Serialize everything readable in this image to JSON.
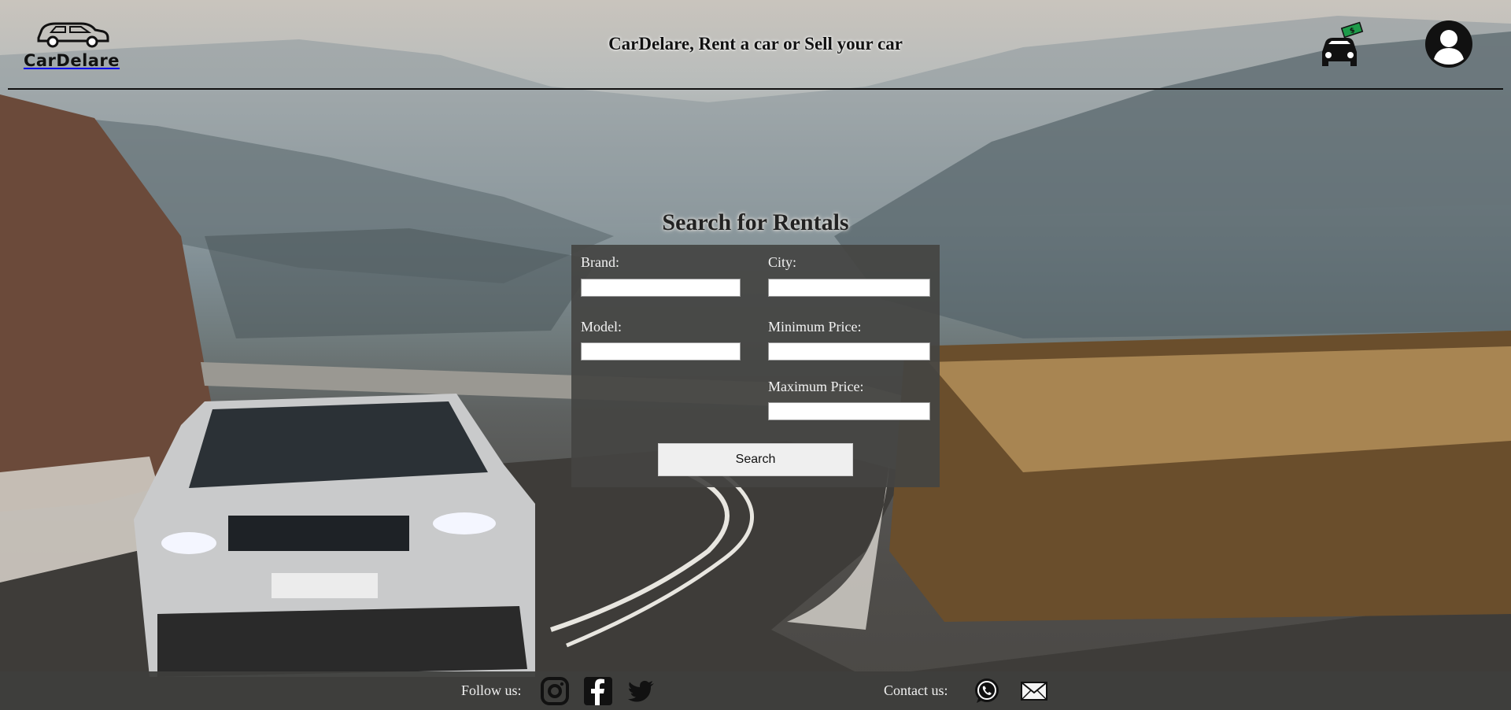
{
  "header": {
    "logo_text": "CarDelare",
    "title": "CarDelare, Rent a car or Sell your car",
    "sell_icon": "car-with-money-icon",
    "profile_icon": "user-avatar-icon"
  },
  "search": {
    "title": "Search for Rentals",
    "fields": {
      "brand": {
        "label": "Brand:",
        "value": ""
      },
      "city": {
        "label": "City:",
        "value": ""
      },
      "model": {
        "label": "Model:",
        "value": ""
      },
      "min_price": {
        "label": "Minimum Price:",
        "value": ""
      },
      "max_price": {
        "label": "Maximum Price:",
        "value": ""
      }
    },
    "button_label": "Search"
  },
  "footer": {
    "follow_label": "Follow us:",
    "contact_label": "Contact us:",
    "social_icons": [
      "instagram-icon",
      "facebook-icon",
      "twitter-icon"
    ],
    "contact_icons": [
      "whatsapp-icon",
      "email-icon"
    ]
  },
  "colors": {
    "panel": "#444442",
    "footer": "#3e3e3c",
    "text_light": "#f2f2f2",
    "text_dark": "#111111"
  }
}
